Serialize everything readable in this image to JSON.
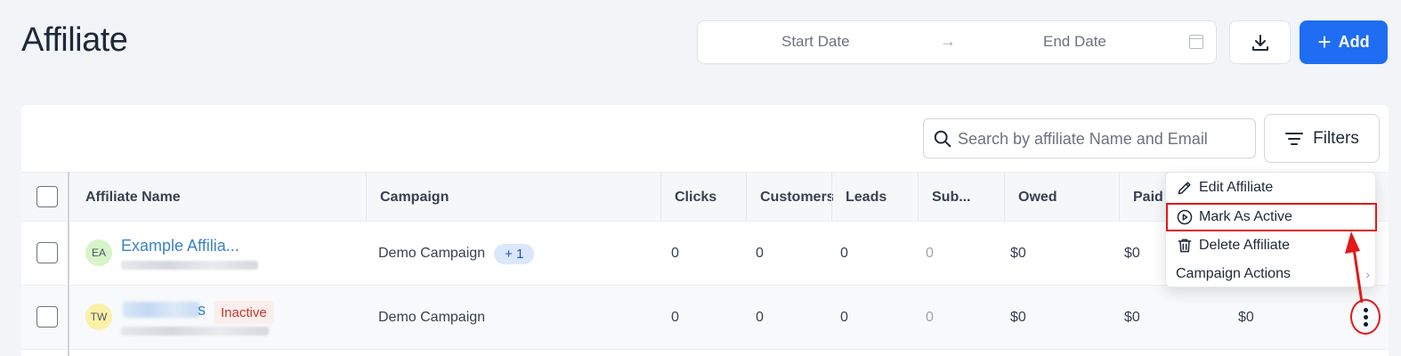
{
  "page": {
    "title": "Affiliate"
  },
  "date_range": {
    "start_placeholder": "Start Date",
    "arrow": "→",
    "end_placeholder": "End Date"
  },
  "toolbar": {
    "add_label": "Add"
  },
  "search": {
    "placeholder": "Search by affiliate Name and Email"
  },
  "filters": {
    "label": "Filters"
  },
  "table": {
    "columns": [
      "Affiliate Name",
      "Campaign",
      "Clicks",
      "Customers",
      "Leads",
      "Sub...",
      "Owed",
      "Paid"
    ],
    "rows": [
      {
        "initials": "EA",
        "avatar_color": "#d7f5c8",
        "name": "Example Affilia...",
        "status": "",
        "campaign": "Demo Campaign",
        "campaign_extra": "+ 1",
        "clicks": "0",
        "customers": "0",
        "leads": "0",
        "sub": "0",
        "owed": "$0",
        "paid": "$0",
        "extra": ""
      },
      {
        "initials": "TW",
        "avatar_color": "#fbf0a8",
        "name": "s",
        "status": "Inactive",
        "campaign": "Demo Campaign",
        "campaign_extra": "",
        "clicks": "0",
        "customers": "0",
        "leads": "0",
        "sub": "0",
        "owed": "$0",
        "paid": "$0",
        "extra": "$0"
      }
    ]
  },
  "action_menu": {
    "items": [
      {
        "label": "Edit Affiliate",
        "icon": "pencil-icon"
      },
      {
        "label": "Mark As Active",
        "icon": "play-circle-icon"
      },
      {
        "label": "Delete Affiliate",
        "icon": "trash-icon"
      },
      {
        "label": "Campaign Actions",
        "icon": ""
      }
    ]
  },
  "colors": {
    "primary": "#1f6df2",
    "highlight": "#e11919",
    "link": "#3b82c4",
    "inactive": "#c0392b"
  }
}
